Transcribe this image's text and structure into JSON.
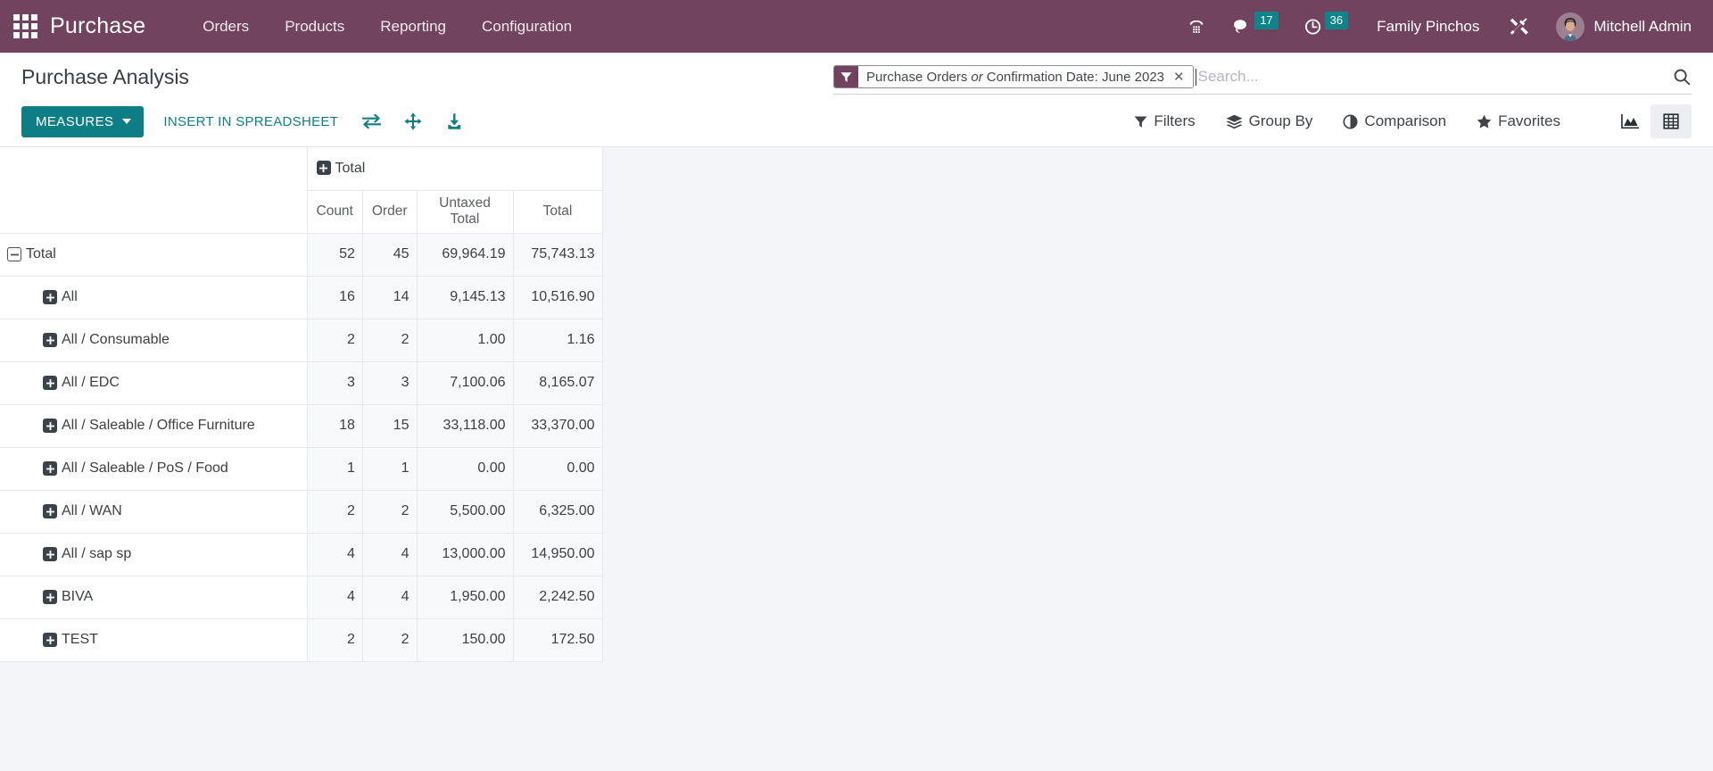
{
  "navbar": {
    "apps_icon": "apps-grid-icon",
    "brand": "Purchase",
    "menu": [
      {
        "label": "Orders"
      },
      {
        "label": "Products"
      },
      {
        "label": "Reporting"
      },
      {
        "label": "Configuration"
      }
    ],
    "sys_icons": [
      {
        "name": "voip-phone-icon",
        "glyph": "☎"
      },
      {
        "name": "messaging-icon",
        "badge": "17"
      },
      {
        "name": "activities-clock-icon",
        "badge": "36"
      }
    ],
    "company": "Family Pinchos",
    "debug_icon": "developer-tools-icon",
    "user": "Mitchell Admin",
    "bg_color": "#71435F",
    "badge_color": "#0d8489"
  },
  "control_panel": {
    "title": "Purchase Analysis",
    "search": {
      "facet": {
        "icon": "filter-funnel-icon",
        "part_one": "Purchase Orders",
        "joiner": "or",
        "part_two": "Confirmation Date: June 2023",
        "remove_label": "✕"
      },
      "placeholder": "Search...",
      "value": "",
      "search_icon": "search-magnifier-icon"
    },
    "buttons": {
      "measures": "MEASURES",
      "insert_spreadsheet": "INSERT IN SPREADSHEET",
      "flip_axis_icon": "flip-axis-icon",
      "expand_all_icon": "expand-all-icon",
      "download_icon": "download-xlsx-icon",
      "accent_color": "#0d7e85"
    },
    "menus": [
      {
        "name": "filters",
        "label": "Filters",
        "icon": "funnel-icon"
      },
      {
        "name": "groupby",
        "label": "Group By",
        "icon": "layers-icon"
      },
      {
        "name": "comparison",
        "label": "Comparison",
        "icon": "half-circle-icon"
      },
      {
        "name": "favorites",
        "label": "Favorites",
        "icon": "star-icon"
      }
    ],
    "views": [
      {
        "name": "graph",
        "icon": "area-chart-icon",
        "active": false
      },
      {
        "name": "pivot",
        "icon": "pivot-table-icon",
        "active": true
      }
    ]
  },
  "pivot": {
    "corner_label": "",
    "column_group": {
      "label": "Total",
      "state": "collapsed",
      "toggle": "plus"
    },
    "measures": [
      "Count",
      "Order",
      "Untaxed Total",
      "Total"
    ],
    "rows": [
      {
        "label": "Total",
        "level": 0,
        "toggle": "minus",
        "values": [
          "52",
          "45",
          "69,964.19",
          "75,743.13"
        ]
      },
      {
        "label": "All",
        "level": 1,
        "toggle": "plus",
        "values": [
          "16",
          "14",
          "9,145.13",
          "10,516.90"
        ]
      },
      {
        "label": "All / Consumable",
        "level": 1,
        "toggle": "plus",
        "values": [
          "2",
          "2",
          "1.00",
          "1.16"
        ]
      },
      {
        "label": "All / EDC",
        "level": 1,
        "toggle": "plus",
        "values": [
          "3",
          "3",
          "7,100.06",
          "8,165.07"
        ]
      },
      {
        "label": "All / Saleable / Office Furniture",
        "level": 1,
        "toggle": "plus",
        "values": [
          "18",
          "15",
          "33,118.00",
          "33,370.00"
        ]
      },
      {
        "label": "All / Saleable / PoS / Food",
        "level": 1,
        "toggle": "plus",
        "values": [
          "1",
          "1",
          "0.00",
          "0.00"
        ]
      },
      {
        "label": "All / WAN",
        "level": 1,
        "toggle": "plus",
        "values": [
          "2",
          "2",
          "5,500.00",
          "6,325.00"
        ]
      },
      {
        "label": "All / sap sp",
        "level": 1,
        "toggle": "plus",
        "values": [
          "4",
          "4",
          "13,000.00",
          "14,950.00"
        ]
      },
      {
        "label": "BIVA",
        "level": 1,
        "toggle": "plus",
        "values": [
          "4",
          "4",
          "1,950.00",
          "2,242.50"
        ]
      },
      {
        "label": "TEST",
        "level": 1,
        "toggle": "plus",
        "values": [
          "2",
          "2",
          "150.00",
          "172.50"
        ]
      }
    ]
  }
}
